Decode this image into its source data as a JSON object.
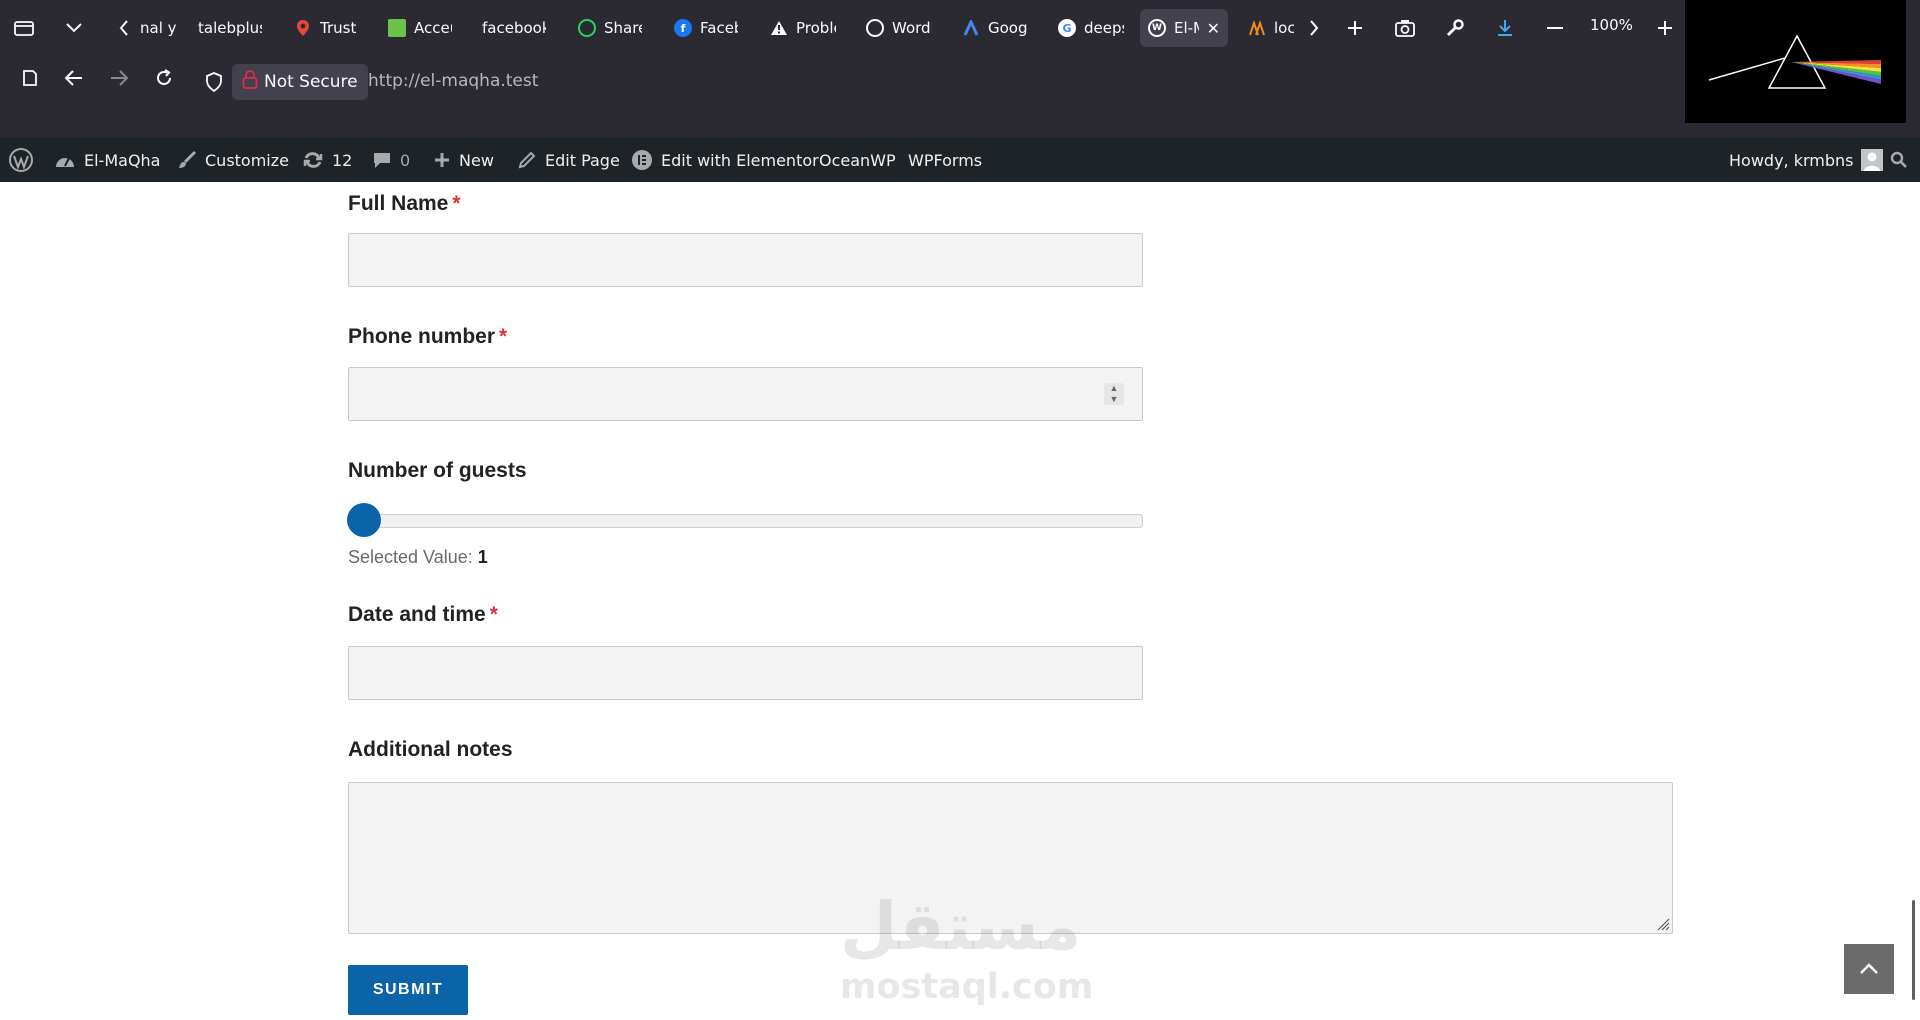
{
  "browser": {
    "tabs": [
      {
        "label": "nal y",
        "icon": "none",
        "color": "#000000"
      },
      {
        "label": "talebplusn",
        "icon": "none",
        "color": "#000000"
      },
      {
        "label": "Trust L",
        "icon": "map-pin-icon",
        "color": "#e8453c"
      },
      {
        "label": "Acceu",
        "icon": "green-page-icon",
        "color": "#6cc24a"
      },
      {
        "label": "facebook.c",
        "icon": "none",
        "color": "#000000"
      },
      {
        "label": "Share",
        "icon": "whatsapp-icon",
        "color": "#25d366"
      },
      {
        "label": "Faceb",
        "icon": "facebook-icon",
        "color": "#1877f2"
      },
      {
        "label": "Proble",
        "icon": "warning-icon",
        "color": "#ffffff"
      },
      {
        "label": "WordI",
        "icon": "openai-icon",
        "color": "#ffffff"
      },
      {
        "label": "Googl",
        "icon": "google-ads-icon",
        "color": "#4285f4"
      },
      {
        "label": "deeps",
        "icon": "google-icon",
        "color": "#ffffff"
      },
      {
        "label": "El-M",
        "icon": "wordpress-icon",
        "color": "#ffffff",
        "active": true
      },
      {
        "label": "loca",
        "icon": "laragon-icon",
        "color": "#f08a24"
      }
    ],
    "zoom": "100%",
    "security_label": "Not Secure",
    "url": "http://el-maqha.test"
  },
  "wp_admin_bar": {
    "site_name": "El-MaQha",
    "customize": "Customize",
    "updates_count": "12",
    "comments_count": "0",
    "new": "New",
    "edit_page": "Edit Page",
    "edit_elementor": "Edit with Elementor",
    "oceanwp": "OceanWP",
    "wpforms": "WPForms",
    "howdy": "Howdy, krmbns"
  },
  "form": {
    "full_name_label": "Full Name",
    "phone_label": "Phone number",
    "guests_label": "Number of guests",
    "selected_value_prefix": "Selected Value:",
    "selected_value": "1",
    "datetime_label": "Date and time",
    "notes_label": "Additional notes",
    "required_mark": "*",
    "submit_label": "SUBMIT",
    "accent_color": "#0b63a8"
  },
  "watermark": {
    "arabic": "مستقل",
    "latin": "mostaql.com"
  }
}
